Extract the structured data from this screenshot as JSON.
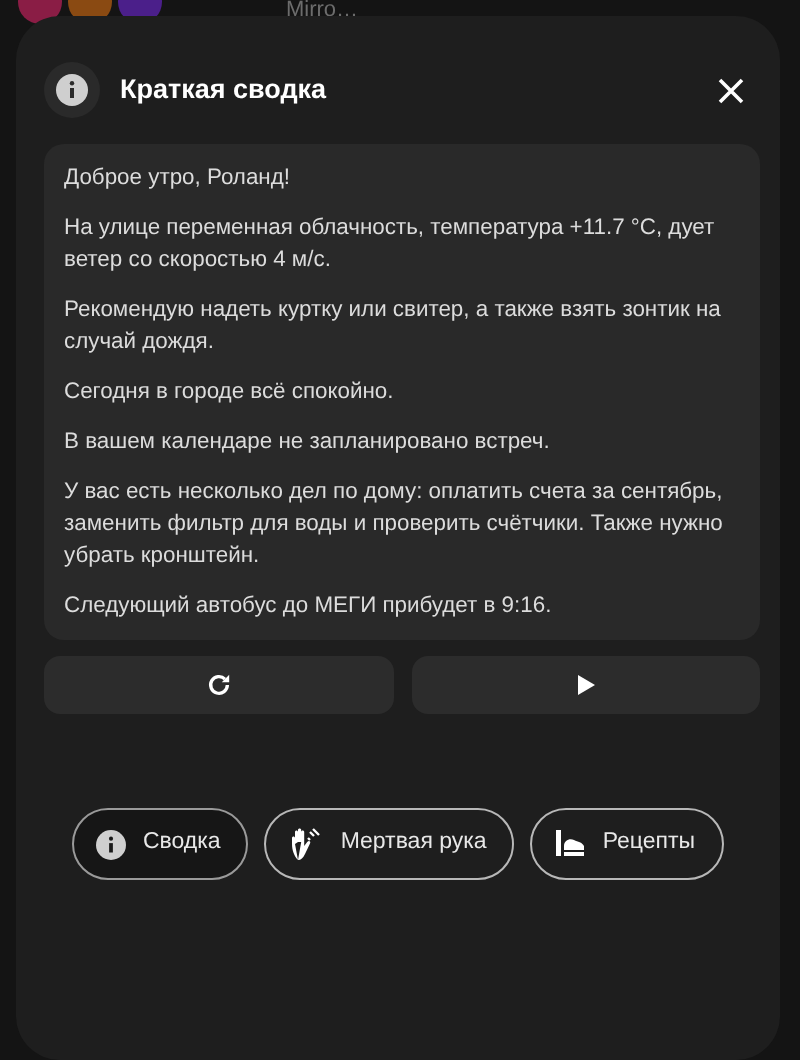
{
  "background": {
    "dots": [
      {
        "color": "#8a1d45"
      },
      {
        "color": "#8a4a12"
      },
      {
        "color": "#4b1f8a"
      }
    ],
    "media_title": "Mirro…"
  },
  "dialog": {
    "title": "Краткая сводка",
    "paragraphs": [
      "Доброе утро, Роланд!",
      "На улице переменная облачность, температура +11.7 °C, дует ветер со скоростью 4 м/с.",
      "Рекомендую надеть куртку или свитер, а также взять зонтик на случай дождя.",
      "Сегодня в городе всё спокойно.",
      "В вашем календаре не запланировано встреч.",
      "У вас есть несколько дел по дому: оплатить счета за сентябрь, заменить фильтр для воды и проверить счётчики. Также нужно убрать кронштейн.",
      "Следующий автобус до МЕГИ прибудет в 9:16."
    ],
    "actions": [
      {
        "kind": "refresh"
      },
      {
        "kind": "play"
      }
    ],
    "chips": [
      {
        "kind": "info",
        "label": "Сводка",
        "selected": true
      },
      {
        "kind": "hand",
        "label": "Мертвая рука",
        "selected": false
      },
      {
        "kind": "recipe",
        "label": "Рецепты",
        "selected": false
      }
    ]
  }
}
